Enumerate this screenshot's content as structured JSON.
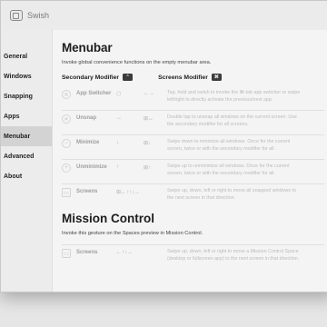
{
  "window": {
    "title": "Swish"
  },
  "sidebar": {
    "items": [
      {
        "label": "General"
      },
      {
        "label": "Windows"
      },
      {
        "label": "Snapping"
      },
      {
        "label": "Apps"
      },
      {
        "label": "Menubar",
        "active": true
      },
      {
        "label": "Advanced"
      },
      {
        "label": "About"
      }
    ]
  },
  "menubar": {
    "heading": "Menubar",
    "description": "Invoke global convenience functions on the empty menubar area.",
    "secondary_label": "Secondary Modifier",
    "secondary_key": "⌃",
    "screens_label": "Screens Modifier",
    "screens_key": "⌘",
    "rows": [
      {
        "icon": "app-switcher-icon",
        "glyph": "✕",
        "label": "App Switcher",
        "gesture": "⬡",
        "mod_gesture": "←→",
        "description_1": "Tap, hold and swish to invoke the ⌘-tab app switcher or swipe",
        "description_2": "left/right to directly activate the previous/next app."
      },
      {
        "icon": "unsnap-icon",
        "glyph": "✕",
        "label": "Unsnap",
        "gesture": "↔",
        "mod_gesture": "⊞↔",
        "description_1": "Double tap to unsnap all windows on the current screen. Use",
        "description_2": "the secondary modifier for all screens."
      },
      {
        "icon": "minimize-icon",
        "glyph": "−",
        "label": "Minimize",
        "gesture": "↓",
        "mod_gesture": "⊞↓",
        "description_1": "Swipe down to minimize all windows. Once for the current",
        "description_2": "screen, twice or with the secondary modifier for all."
      },
      {
        "icon": "unminimize-icon",
        "glyph": "+",
        "label": "Unminimize",
        "gesture": "↑",
        "mod_gesture": "⊞↑",
        "description_1": "Swipe up to unminimize all windows. Once for the current",
        "description_2": "screen, twice or with the secondary modifier for all."
      },
      {
        "icon": "screens-icon",
        "glyph": "▭",
        "label": "Screens",
        "gesture": "⊞←↑↑↓→",
        "mod_gesture": "",
        "description_1": "Swipe up, down, left or right to move all snapped windows to",
        "description_2": "the next screen in that direction."
      }
    ]
  },
  "mission_control": {
    "heading": "Mission Control",
    "description": "Invoke this gesture on the Spaces preview in Mission Control.",
    "row": {
      "icon": "screens-icon",
      "glyph": "▭",
      "label": "Screens",
      "gesture": "←↑↓→",
      "description_1": "Swipe up, down, left or right to move a Mission Control Space",
      "description_2": "(desktop or fullscreen app) to the next screen in that direction."
    }
  }
}
